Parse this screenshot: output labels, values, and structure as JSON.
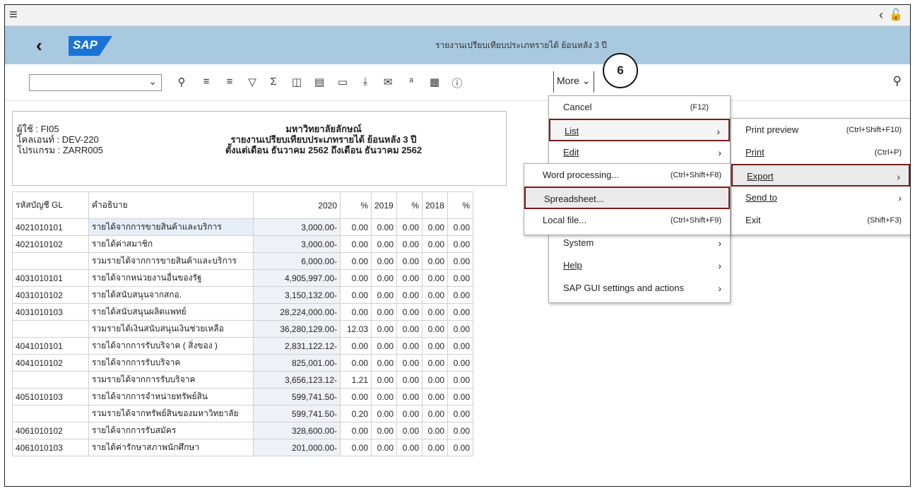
{
  "shell": {
    "header_title": "รายงานเปรียบเทียบประเภทรายได้ ย้อนหลัง 3 ปี",
    "step_number": "6",
    "more_label": "More"
  },
  "toolbar": {
    "layout_value": ""
  },
  "report": {
    "user_label": "ผู้ใช้ : FI05",
    "client_label": "ไคลเอนท์ : DEV-220",
    "program_label": "โปรแกรม : ZARR005",
    "org": "มหาวิทยาลัยลักษณ์",
    "title": "รายงานเปรียบเทียบประเภทรายได้ ย้อนหลัง 3 ปี",
    "period": "ตั้งแต่เดือน ธันวาคม 2562 ถึงเดือน ธันวาคม 2562"
  },
  "table": {
    "headers": [
      "รหัสบัญชี GL",
      "คำอธิบาย",
      "2020",
      "%",
      "2019",
      "%",
      "2018",
      "%"
    ],
    "rows": [
      [
        "4021010101",
        "รายได้จากการขายสินค้าและบริการ",
        "3,000.00-",
        "0.00",
        "0.00",
        "0.00",
        "0.00",
        "0.00"
      ],
      [
        "4021010102",
        "รายได้ค่าสมาชิก",
        "3,000.00-",
        "0.00",
        "0.00",
        "0.00",
        "0.00",
        "0.00"
      ],
      [
        "",
        "รวมรายได้จากการขายสินค้าและบริการ",
        "6,000.00-",
        "0.00",
        "0.00",
        "0.00",
        "0.00",
        "0.00"
      ],
      [
        "4031010101",
        "รายได้จากหน่วยงานอื่นของรัฐ",
        "4,905,997.00-",
        "0.00",
        "0.00",
        "0.00",
        "0.00",
        "0.00"
      ],
      [
        "4031010102",
        "รายได้สนับสนุนจากสกอ.",
        "3,150,132.00-",
        "0.00",
        "0.00",
        "0.00",
        "0.00",
        "0.00"
      ],
      [
        "4031010103",
        "รายได้สนับสนุนผลิตแพทย์",
        "28,224,000.00-",
        "0.00",
        "0.00",
        "0.00",
        "0.00",
        "0.00"
      ],
      [
        "",
        "รวมรายได้เงินสนับสนุนเงินช่วยเหลือ",
        "36,280,129.00-",
        "12.03",
        "0.00",
        "0.00",
        "0.00",
        "0.00"
      ],
      [
        "4041010101",
        "รายได้จากการรับบริจาค ( สิ่งของ )",
        "2,831,122.12-",
        "0.00",
        "0.00",
        "0.00",
        "0.00",
        "0.00"
      ],
      [
        "4041010102",
        "รายได้จากการรับบริจาค",
        "825,001.00-",
        "0.00",
        "0.00",
        "0.00",
        "0.00",
        "0.00"
      ],
      [
        "",
        "รวมรายได้จากการรับบริจาค",
        "3,656,123.12-",
        "1.21",
        "0.00",
        "0.00",
        "0.00",
        "0.00"
      ],
      [
        "4051010103",
        "รายได้จากการจำหน่ายทรัพย์สิน",
        "599,741.50-",
        "0.00",
        "0.00",
        "0.00",
        "0.00",
        "0.00"
      ],
      [
        "",
        "รวมรายได้จากทรัพย์สินของมหาวิทยาลัย",
        "599,741.50-",
        "0.20",
        "0.00",
        "0.00",
        "0.00",
        "0.00"
      ],
      [
        "4061010102",
        "รายได้จากการรับสมัคร",
        "328,600.00-",
        "0.00",
        "0.00",
        "0.00",
        "0.00",
        "0.00"
      ],
      [
        "4061010103",
        "รายได้ค่ารักษาสภาพนักศึกษา",
        "201,000.00-",
        "0.00",
        "0.00",
        "0.00",
        "0.00",
        "0.00"
      ]
    ]
  },
  "more_menu": {
    "cancel": "Cancel",
    "cancel_sc": "(F12)",
    "list": "List",
    "edit": "Edit",
    "system": "System",
    "help": "Help",
    "gui": "SAP GUI settings and actions"
  },
  "list_menu": {
    "print_preview": "Print preview",
    "print_preview_sc": "(Ctrl+Shift+F10)",
    "print": "Print",
    "print_sc": "(Ctrl+P)",
    "export": "Export",
    "send_to": "Send to",
    "exit": "Exit",
    "exit_sc": "(Shift+F3)"
  },
  "export_menu": {
    "word": "Word processing...",
    "word_sc": "(Ctrl+Shift+F8)",
    "spreadsheet": "Spreadsheet...",
    "local": "Local file...",
    "local_sc": "(Ctrl+Shift+F9)"
  }
}
